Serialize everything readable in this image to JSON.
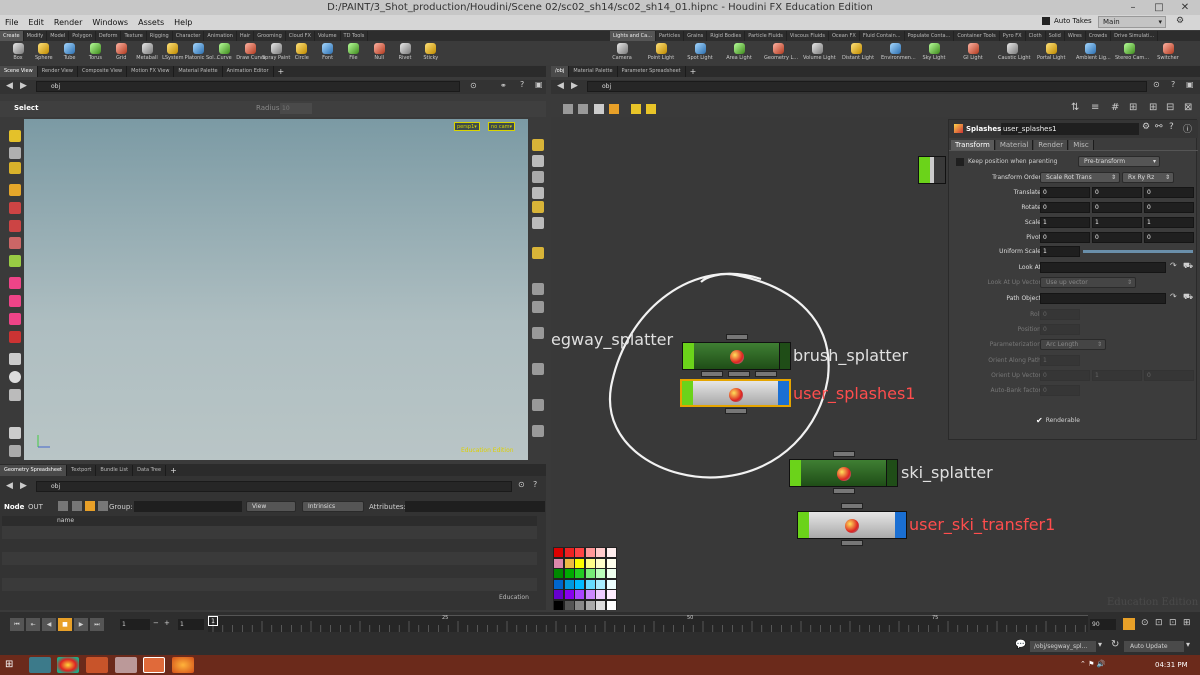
{
  "app": {
    "title": "D:/PAINT/3_Shot_production/Houdini/Scene 02/sc02_sh14/sc02_sh14_01.hipnc - Houdini FX Education Edition",
    "menu": [
      "File",
      "Edit",
      "Render",
      "Windows",
      "Assets",
      "Help"
    ],
    "auto_takes": "Auto Takes",
    "desktop": "Main"
  },
  "shelf_tabs_left": [
    "Create",
    "Modify",
    "Model",
    "Polygon",
    "Deform",
    "Texture",
    "Rigging",
    "Character",
    "Animation",
    "Hair",
    "Grooming",
    "Cloud FX",
    "Volume",
    "TD Tools"
  ],
  "shelf_tabs_right": [
    "Lights and Ca...",
    "Particles",
    "Grains",
    "Rigid Bodies",
    "Particle Fluids",
    "Viscous Fluids",
    "Ocean FX",
    "Fluid Contain...",
    "Populate Conta...",
    "Container Tools",
    "Pyro FX",
    "Cloth",
    "Solid",
    "Wires",
    "Crowds",
    "Drive Simulati..."
  ],
  "shelf_tools_left": [
    {
      "label": "Box",
      "icon": "box-icon"
    },
    {
      "label": "Sphere",
      "icon": "sphere-icon"
    },
    {
      "label": "Tube",
      "icon": "tube-icon"
    },
    {
      "label": "Torus",
      "icon": "torus-icon"
    },
    {
      "label": "Grid",
      "icon": "grid-icon"
    },
    {
      "label": "Metaball",
      "icon": "metaball-icon"
    },
    {
      "label": "LSystem",
      "icon": "lsystem-icon"
    },
    {
      "label": "Platonic Sol...",
      "icon": "platonic-icon"
    },
    {
      "label": "Curve",
      "icon": "curve-icon"
    },
    {
      "label": "Draw Curve",
      "icon": "draw-curve-icon"
    },
    {
      "label": "Spray Paint",
      "icon": "spray-paint-icon"
    },
    {
      "label": "Circle",
      "icon": "circle-icon"
    },
    {
      "label": "Font",
      "icon": "font-icon"
    },
    {
      "label": "File",
      "icon": "file-icon"
    },
    {
      "label": "Null",
      "icon": "null-icon"
    },
    {
      "label": "Rivet",
      "icon": "rivet-icon"
    },
    {
      "label": "Sticky",
      "icon": "sticky-icon"
    }
  ],
  "shelf_tools_right": [
    {
      "label": "Camera",
      "icon": "camera-icon"
    },
    {
      "label": "Point Light",
      "icon": "point-light-icon"
    },
    {
      "label": "Spot Light",
      "icon": "spot-light-icon"
    },
    {
      "label": "Area Light",
      "icon": "area-light-icon"
    },
    {
      "label": "Geometry L...",
      "icon": "geometry-light-icon"
    },
    {
      "label": "Volume Light",
      "icon": "volume-light-icon"
    },
    {
      "label": "Distant Light",
      "icon": "distant-light-icon"
    },
    {
      "label": "Environmen...",
      "icon": "environment-light-icon"
    },
    {
      "label": "Sky Light",
      "icon": "sky-light-icon"
    },
    {
      "label": "GI Light",
      "icon": "gi-light-icon"
    },
    {
      "label": "Caustic Light",
      "icon": "caustic-light-icon"
    },
    {
      "label": "Portal Light",
      "icon": "portal-light-icon"
    },
    {
      "label": "Ambient Lig...",
      "icon": "ambient-light-icon"
    },
    {
      "label": "Stereo Cam...",
      "icon": "stereo-camera-icon"
    },
    {
      "label": "Switcher",
      "icon": "switcher-icon"
    }
  ],
  "left_pane": {
    "tabs": [
      "Scene View",
      "Render View",
      "Composite View",
      "Motion FX View",
      "Material Palette",
      "Animation Editor"
    ],
    "path": "obj",
    "tool_name": "Select",
    "radius_label": "Radius",
    "radius_value": "10",
    "persp": "persp1",
    "cam": "no cam",
    "watermark": "Education Edition"
  },
  "right_pane": {
    "tabs": [
      "/obj",
      "Material Palette",
      "Parameter Spreadsheet"
    ],
    "path": "obj"
  },
  "nodes": [
    {
      "label": "egway_splatter",
      "color": "#e0e0e0"
    },
    {
      "label": "brush_splatter",
      "color": "#e0e0e0"
    },
    {
      "label": "user_splashes1",
      "color": "#ff4d4d"
    },
    {
      "label": "ski_splatter",
      "color": "#e0e0e0"
    },
    {
      "label": "user_ski_transfer1",
      "color": "#ff4d4d"
    }
  ],
  "net_watermark": "Education Edition",
  "params": {
    "node_type": "Splashes",
    "node_name": "user_splashes1",
    "tabs": [
      "Transform",
      "Material",
      "Render",
      "Misc"
    ],
    "keep_position": "Keep position when parenting",
    "keep_position_value": "Pre-transform",
    "transform_order_label": "Transform Order",
    "transform_order": "Scale Rot Trans",
    "rot_order": "Rx Ry Rz",
    "translate_label": "Translate",
    "translate": [
      "0",
      "0",
      "0"
    ],
    "rotate_label": "Rotate",
    "rotate": [
      "0",
      "0",
      "0"
    ],
    "scale_label": "Scale",
    "scale": [
      "1",
      "1",
      "1"
    ],
    "pivot_label": "Pivot",
    "pivot": [
      "0",
      "0",
      "0"
    ],
    "uniform_scale_label": "Uniform Scale",
    "uniform_scale": "1",
    "look_at_label": "Look At",
    "look_at_up_label": "Look At Up Vector",
    "look_at_up": "Use up vector",
    "path_object_label": "Path Object",
    "roll_label": "Roll",
    "roll": "0",
    "position_label": "Position",
    "position": "0",
    "param_label": "Parameterization",
    "param": "Arc Length",
    "orient_path_label": "Orient Along Path",
    "orient_path": "1",
    "orient_up_label": "Orient Up Vector",
    "orient_up": [
      "0",
      "1",
      "0"
    ],
    "autobank_label": "Auto-Bank factor",
    "autobank": "0",
    "renderable": "Renderable"
  },
  "spreadsheet": {
    "tabs": [
      "Geometry Spreadsheet",
      "Textport",
      "Bundle List",
      "Data Tree"
    ],
    "path": "obj",
    "node_label": "Node",
    "node_value": "OUT",
    "group_label": "Group:",
    "view": "View",
    "intrinsics": "Intrinsics",
    "attributes_label": "Attributes:",
    "col_name": "name",
    "watermark": "Education"
  },
  "timeline": {
    "frame": "1",
    "start": "1",
    "end": "90",
    "current": "1",
    "ticks": [
      "25",
      "50",
      "75"
    ]
  },
  "status": {
    "path": "/obj/segway_spl...",
    "auto_update": "Auto Update"
  },
  "taskbar": {
    "time": "04:31 PM"
  },
  "colors": {
    "node_green_bar": "#6bd31a",
    "node_blue_flag": "#1a6fd3",
    "selected_outline": "#e5a400",
    "label_red": "#ff4d4d"
  }
}
